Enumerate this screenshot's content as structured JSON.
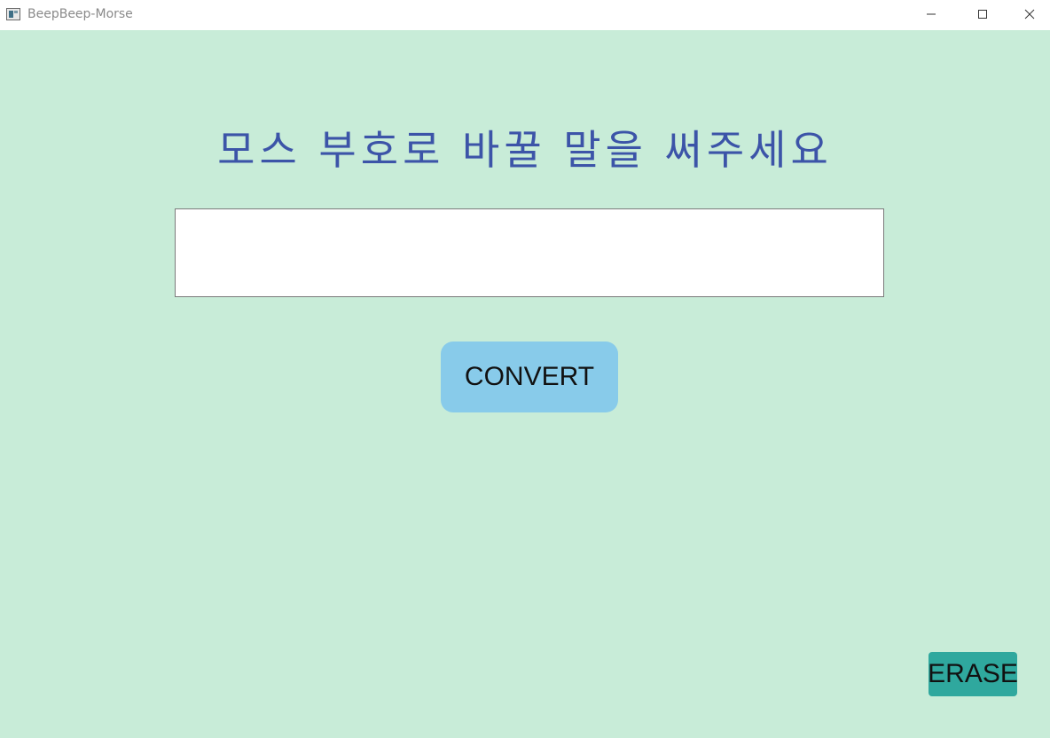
{
  "window": {
    "title": "BeepBeep-Morse",
    "controls": {
      "minimize_icon": "minimize-icon",
      "maximize_icon": "maximize-icon",
      "close_icon": "close-icon"
    }
  },
  "main": {
    "heading": "모스 부호로 바꿀 말을 써주세요",
    "input": {
      "value": "",
      "placeholder": ""
    },
    "convert_label": "CONVERT",
    "erase_label": "ERASE"
  },
  "colors": {
    "background": "#c8ecd8",
    "heading": "#3c54a8",
    "convert_button": "#88cbea",
    "erase_button": "#2fa89e"
  }
}
